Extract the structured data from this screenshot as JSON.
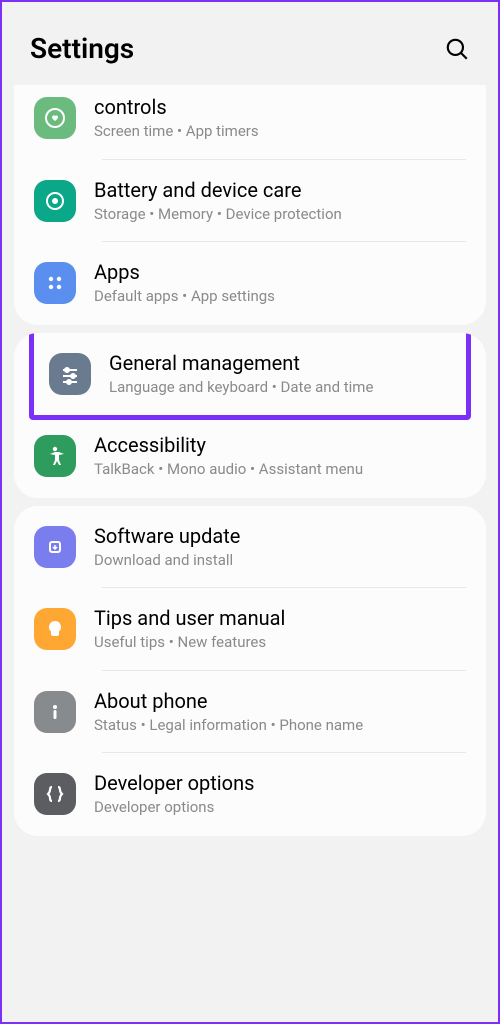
{
  "header": {
    "title": "Settings"
  },
  "groups": [
    {
      "items": [
        {
          "id": "controls",
          "title": "controls",
          "subtitle": "Screen time  •  App timers",
          "icon": "heart-circle",
          "color": "icon-green-heart"
        },
        {
          "id": "battery",
          "title": "Battery and device care",
          "subtitle": "Storage  •  Memory  •  Device protection",
          "icon": "refresh",
          "color": "icon-teal"
        },
        {
          "id": "apps",
          "title": "Apps",
          "subtitle": "Default apps  •  App settings",
          "icon": "grid",
          "color": "icon-blue"
        }
      ]
    },
    {
      "items": [
        {
          "id": "general",
          "title": "General management",
          "subtitle": "Language and keyboard  •  Date and time",
          "icon": "sliders",
          "color": "icon-grayblue",
          "highlighted": true
        },
        {
          "id": "accessibility",
          "title": "Accessibility",
          "subtitle": "TalkBack  •  Mono audio  •  Assistant menu",
          "icon": "person",
          "color": "icon-green"
        }
      ]
    },
    {
      "items": [
        {
          "id": "software",
          "title": "Software update",
          "subtitle": "Download and install",
          "icon": "download",
          "color": "icon-purple"
        },
        {
          "id": "tips",
          "title": "Tips and user manual",
          "subtitle": "Useful tips  •  New features",
          "icon": "bulb",
          "color": "icon-orange"
        },
        {
          "id": "about",
          "title": "About phone",
          "subtitle": "Status  •  Legal information  •  Phone name",
          "icon": "info",
          "color": "icon-gray"
        },
        {
          "id": "developer",
          "title": "Developer options",
          "subtitle": "Developer options",
          "icon": "braces",
          "color": "icon-darkgray"
        }
      ]
    }
  ]
}
